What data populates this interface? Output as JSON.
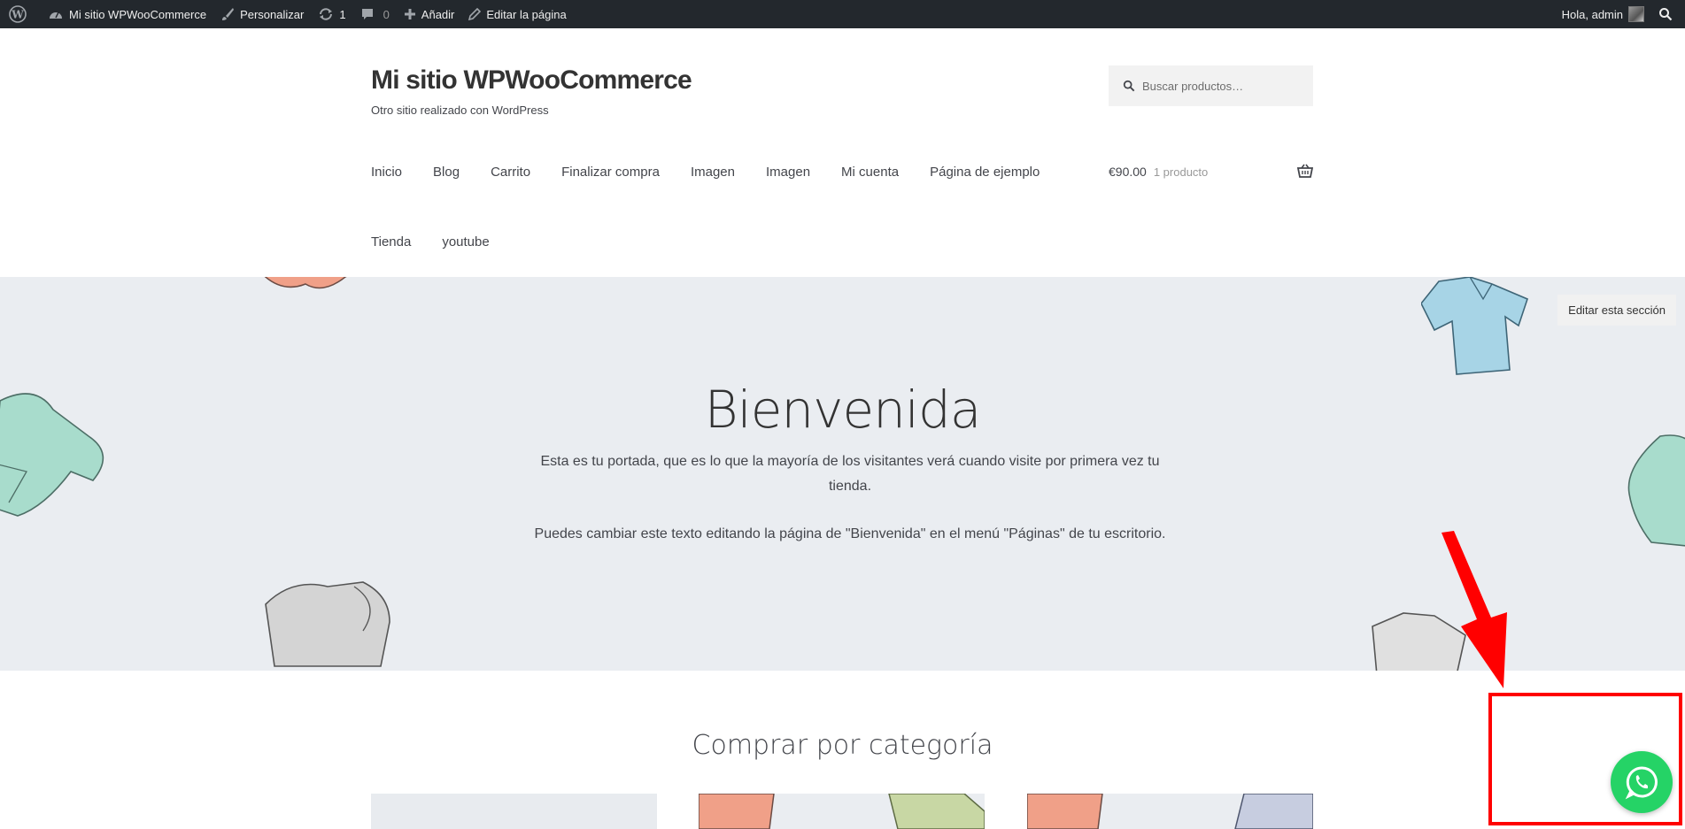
{
  "adminbar": {
    "site_name": "Mi sitio WPWooCommerce",
    "customize": "Personalizar",
    "updates_count": "1",
    "comments_count": "0",
    "add_new": "Añadir",
    "edit_page": "Editar la página",
    "greeting": "Hola, admin"
  },
  "header": {
    "title": "Mi sitio WPWooCommerce",
    "description": "Otro sitio realizado con WordPress",
    "search_placeholder": "Buscar productos…"
  },
  "nav": {
    "items": [
      "Inicio",
      "Blog",
      "Carrito",
      "Finalizar compra",
      "Imagen",
      "Imagen",
      "Mi cuenta",
      "Página de ejemplo"
    ],
    "items_row2": [
      "Tienda",
      "youtube"
    ]
  },
  "cart": {
    "amount": "€90.00",
    "count": "1 producto"
  },
  "hero": {
    "title": "Bienvenida",
    "paragraph1": "Esta es tu portada, que es lo que la mayoría de los visitantes verá cuando visite por primera vez tu tienda.",
    "paragraph2": "Puedes cambiar este texto editando la página de \"Bienvenida\" en el menú \"Páginas\" de tu escritorio.",
    "edit_section": "Editar esta sección"
  },
  "categories": {
    "title": "Comprar por categoría"
  },
  "colors": {
    "adminbar": "#23282d",
    "hero_bg": "#eaedf1",
    "annotation": "#ff0000",
    "whatsapp": "#25d366"
  },
  "icons": [
    "wordpress-icon",
    "dashboard-icon",
    "brush-icon",
    "updates-icon",
    "comment-icon",
    "plus-icon",
    "pencil-icon",
    "search-icon",
    "basket-icon",
    "whatsapp-icon"
  ]
}
